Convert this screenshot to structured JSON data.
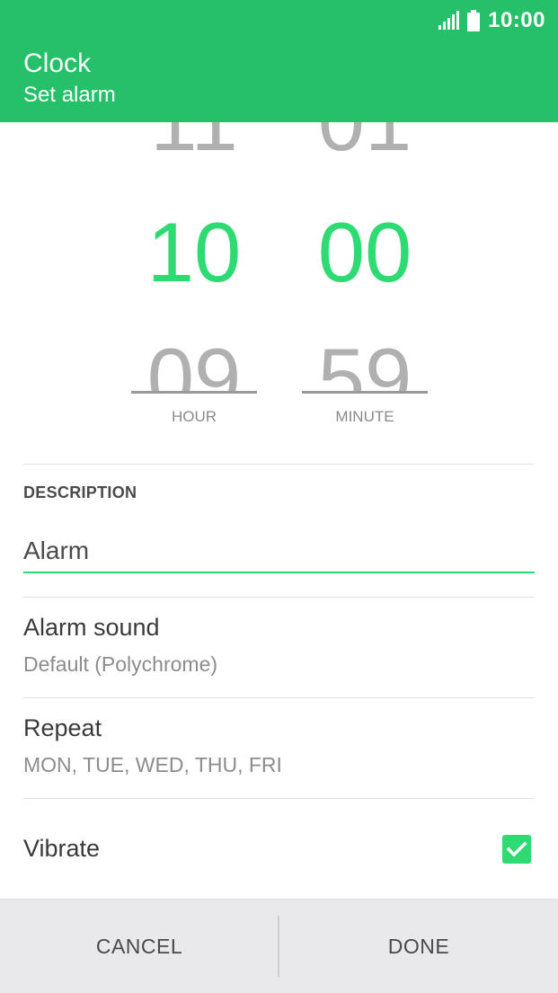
{
  "status_bar": {
    "time": "10:00",
    "signal_icon": "signal-icon",
    "battery_icon": "battery-icon"
  },
  "header": {
    "title": "Clock",
    "subtitle": "Set alarm"
  },
  "picker": {
    "hour": {
      "prev": "11",
      "current": "10",
      "next": "09",
      "label": "HOUR"
    },
    "minute": {
      "prev": "01",
      "current": "00",
      "next": "59",
      "label": "MINUTE"
    }
  },
  "description": {
    "label": "DESCRIPTION",
    "value": "Alarm"
  },
  "alarm_sound": {
    "title": "Alarm sound",
    "value": "Default (Polychrome)"
  },
  "repeat": {
    "title": "Repeat",
    "value": "MON, TUE, WED, THU, FRI"
  },
  "vibrate": {
    "title": "Vibrate",
    "checked": true
  },
  "buttons": {
    "cancel": "CANCEL",
    "done": "DONE"
  },
  "colors": {
    "header": "#27c06a",
    "accent": "#2edb72",
    "bottom_bar": "#e9e9eb"
  }
}
